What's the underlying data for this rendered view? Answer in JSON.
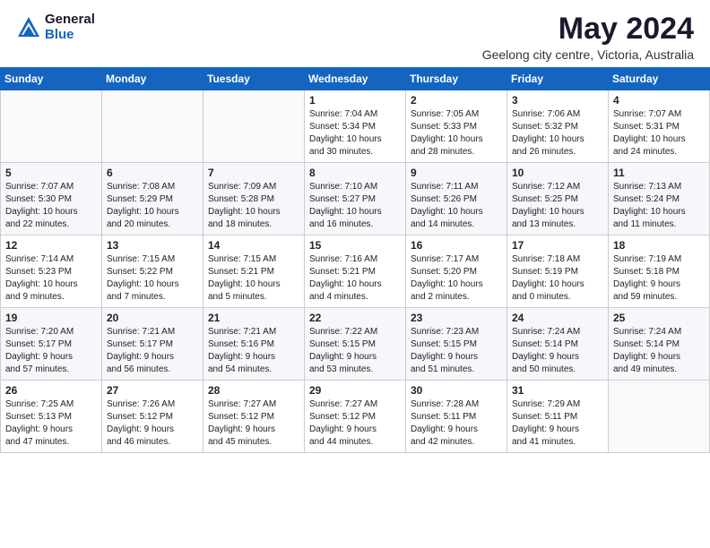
{
  "header": {
    "logo_general": "General",
    "logo_blue": "Blue",
    "month_title": "May 2024",
    "location": "Geelong city centre, Victoria, Australia"
  },
  "weekdays": [
    "Sunday",
    "Monday",
    "Tuesday",
    "Wednesday",
    "Thursday",
    "Friday",
    "Saturday"
  ],
  "weeks": [
    [
      {
        "day": "",
        "info": ""
      },
      {
        "day": "",
        "info": ""
      },
      {
        "day": "",
        "info": ""
      },
      {
        "day": "1",
        "info": "Sunrise: 7:04 AM\nSunset: 5:34 PM\nDaylight: 10 hours\nand 30 minutes."
      },
      {
        "day": "2",
        "info": "Sunrise: 7:05 AM\nSunset: 5:33 PM\nDaylight: 10 hours\nand 28 minutes."
      },
      {
        "day": "3",
        "info": "Sunrise: 7:06 AM\nSunset: 5:32 PM\nDaylight: 10 hours\nand 26 minutes."
      },
      {
        "day": "4",
        "info": "Sunrise: 7:07 AM\nSunset: 5:31 PM\nDaylight: 10 hours\nand 24 minutes."
      }
    ],
    [
      {
        "day": "5",
        "info": "Sunrise: 7:07 AM\nSunset: 5:30 PM\nDaylight: 10 hours\nand 22 minutes."
      },
      {
        "day": "6",
        "info": "Sunrise: 7:08 AM\nSunset: 5:29 PM\nDaylight: 10 hours\nand 20 minutes."
      },
      {
        "day": "7",
        "info": "Sunrise: 7:09 AM\nSunset: 5:28 PM\nDaylight: 10 hours\nand 18 minutes."
      },
      {
        "day": "8",
        "info": "Sunrise: 7:10 AM\nSunset: 5:27 PM\nDaylight: 10 hours\nand 16 minutes."
      },
      {
        "day": "9",
        "info": "Sunrise: 7:11 AM\nSunset: 5:26 PM\nDaylight: 10 hours\nand 14 minutes."
      },
      {
        "day": "10",
        "info": "Sunrise: 7:12 AM\nSunset: 5:25 PM\nDaylight: 10 hours\nand 13 minutes."
      },
      {
        "day": "11",
        "info": "Sunrise: 7:13 AM\nSunset: 5:24 PM\nDaylight: 10 hours\nand 11 minutes."
      }
    ],
    [
      {
        "day": "12",
        "info": "Sunrise: 7:14 AM\nSunset: 5:23 PM\nDaylight: 10 hours\nand 9 minutes."
      },
      {
        "day": "13",
        "info": "Sunrise: 7:15 AM\nSunset: 5:22 PM\nDaylight: 10 hours\nand 7 minutes."
      },
      {
        "day": "14",
        "info": "Sunrise: 7:15 AM\nSunset: 5:21 PM\nDaylight: 10 hours\nand 5 minutes."
      },
      {
        "day": "15",
        "info": "Sunrise: 7:16 AM\nSunset: 5:21 PM\nDaylight: 10 hours\nand 4 minutes."
      },
      {
        "day": "16",
        "info": "Sunrise: 7:17 AM\nSunset: 5:20 PM\nDaylight: 10 hours\nand 2 minutes."
      },
      {
        "day": "17",
        "info": "Sunrise: 7:18 AM\nSunset: 5:19 PM\nDaylight: 10 hours\nand 0 minutes."
      },
      {
        "day": "18",
        "info": "Sunrise: 7:19 AM\nSunset: 5:18 PM\nDaylight: 9 hours\nand 59 minutes."
      }
    ],
    [
      {
        "day": "19",
        "info": "Sunrise: 7:20 AM\nSunset: 5:17 PM\nDaylight: 9 hours\nand 57 minutes."
      },
      {
        "day": "20",
        "info": "Sunrise: 7:21 AM\nSunset: 5:17 PM\nDaylight: 9 hours\nand 56 minutes."
      },
      {
        "day": "21",
        "info": "Sunrise: 7:21 AM\nSunset: 5:16 PM\nDaylight: 9 hours\nand 54 minutes."
      },
      {
        "day": "22",
        "info": "Sunrise: 7:22 AM\nSunset: 5:15 PM\nDaylight: 9 hours\nand 53 minutes."
      },
      {
        "day": "23",
        "info": "Sunrise: 7:23 AM\nSunset: 5:15 PM\nDaylight: 9 hours\nand 51 minutes."
      },
      {
        "day": "24",
        "info": "Sunrise: 7:24 AM\nSunset: 5:14 PM\nDaylight: 9 hours\nand 50 minutes."
      },
      {
        "day": "25",
        "info": "Sunrise: 7:24 AM\nSunset: 5:14 PM\nDaylight: 9 hours\nand 49 minutes."
      }
    ],
    [
      {
        "day": "26",
        "info": "Sunrise: 7:25 AM\nSunset: 5:13 PM\nDaylight: 9 hours\nand 47 minutes."
      },
      {
        "day": "27",
        "info": "Sunrise: 7:26 AM\nSunset: 5:12 PM\nDaylight: 9 hours\nand 46 minutes."
      },
      {
        "day": "28",
        "info": "Sunrise: 7:27 AM\nSunset: 5:12 PM\nDaylight: 9 hours\nand 45 minutes."
      },
      {
        "day": "29",
        "info": "Sunrise: 7:27 AM\nSunset: 5:12 PM\nDaylight: 9 hours\nand 44 minutes."
      },
      {
        "day": "30",
        "info": "Sunrise: 7:28 AM\nSunset: 5:11 PM\nDaylight: 9 hours\nand 42 minutes."
      },
      {
        "day": "31",
        "info": "Sunrise: 7:29 AM\nSunset: 5:11 PM\nDaylight: 9 hours\nand 41 minutes."
      },
      {
        "day": "",
        "info": ""
      }
    ]
  ]
}
